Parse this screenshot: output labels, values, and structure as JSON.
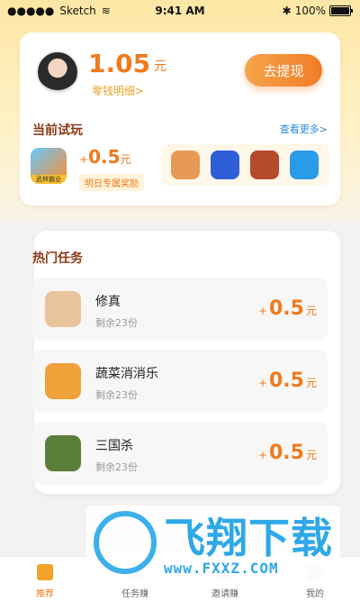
{
  "status_bar": {
    "carrier": "Sketch",
    "time": "9:41 AM",
    "battery": "100%"
  },
  "wallet": {
    "amount": "1.05",
    "unit": "元",
    "detail_link": "零钱明细>",
    "withdraw_button": "去提现"
  },
  "current_trial": {
    "title": "当前试玩",
    "more": "查看更多>",
    "game_tag": "武林霸业",
    "reward_sign": "+",
    "reward_amount": "0.5",
    "reward_unit": "元",
    "badge": "明日专属奖励",
    "apps": [
      {
        "icon": "mahjong-app-icon",
        "color": "#e79a56"
      },
      {
        "icon": "blue-y-app-icon",
        "color": "#2f5fd8"
      },
      {
        "icon": "hero-game-app-icon",
        "color": "#b64a2c"
      },
      {
        "icon": "blue-brand-app-icon",
        "color": "#2a9be6"
      }
    ]
  },
  "hot_tasks": {
    "title": "热门任务",
    "items": [
      {
        "name": "修真",
        "remaining": "剩余23份",
        "sign": "+",
        "reward": "0.5",
        "unit": "元",
        "icon_color": "#e9c39c"
      },
      {
        "name": "蔬菜消消乐",
        "remaining": "剩余23份",
        "sign": "+",
        "reward": "0.5",
        "unit": "元",
        "icon_color": "#f0a13a"
      },
      {
        "name": "三国杀",
        "remaining": "剩余23份",
        "sign": "+",
        "reward": "0.5",
        "unit": "元",
        "icon_color": "#5b7f3a"
      }
    ]
  },
  "tabs": [
    {
      "label": "推荐",
      "active": true
    },
    {
      "label": "任务赚",
      "active": false
    },
    {
      "label": "邀请赚",
      "active": false
    },
    {
      "label": "我的",
      "active": false
    }
  ],
  "watermark": {
    "text": "飞翔下载",
    "url": "www.FXXZ.COM"
  },
  "colors": {
    "accent": "#f07a1c",
    "link": "#2a8ad7",
    "section_title": "#8b3a14"
  }
}
